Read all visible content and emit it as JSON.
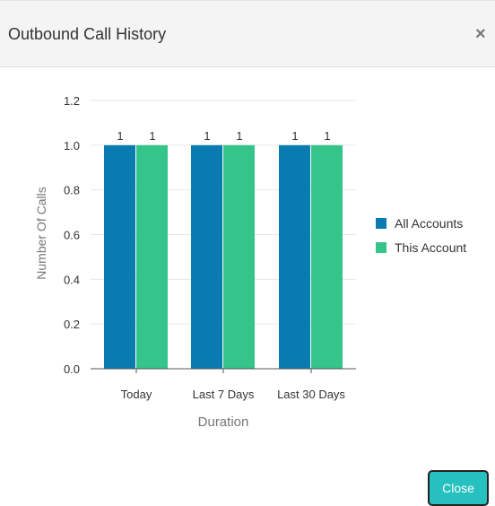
{
  "modal": {
    "title": "Outbound Call History",
    "close_icon_glyph": "×",
    "close_button_label": "Close"
  },
  "colors": {
    "all_accounts": "#0a7bb0",
    "this_account": "#35c48a",
    "close_button": "#26c0bf"
  },
  "chart_data": {
    "type": "bar",
    "categories": [
      "Today",
      "Last 7 Days",
      "Last 30 Days"
    ],
    "series": [
      {
        "name": "All Accounts",
        "values": [
          1,
          1,
          1
        ]
      },
      {
        "name": "This Account",
        "values": [
          1,
          1,
          1
        ]
      }
    ],
    "xlabel": "Duration",
    "ylabel": "Number Of Calls",
    "ylim": [
      0,
      1.2
    ],
    "yticks": [
      "0.0",
      "0.2",
      "0.4",
      "0.6",
      "0.8",
      "1.0",
      "1.2"
    ],
    "data_labels": true,
    "grid": true,
    "legend_position": "right"
  }
}
